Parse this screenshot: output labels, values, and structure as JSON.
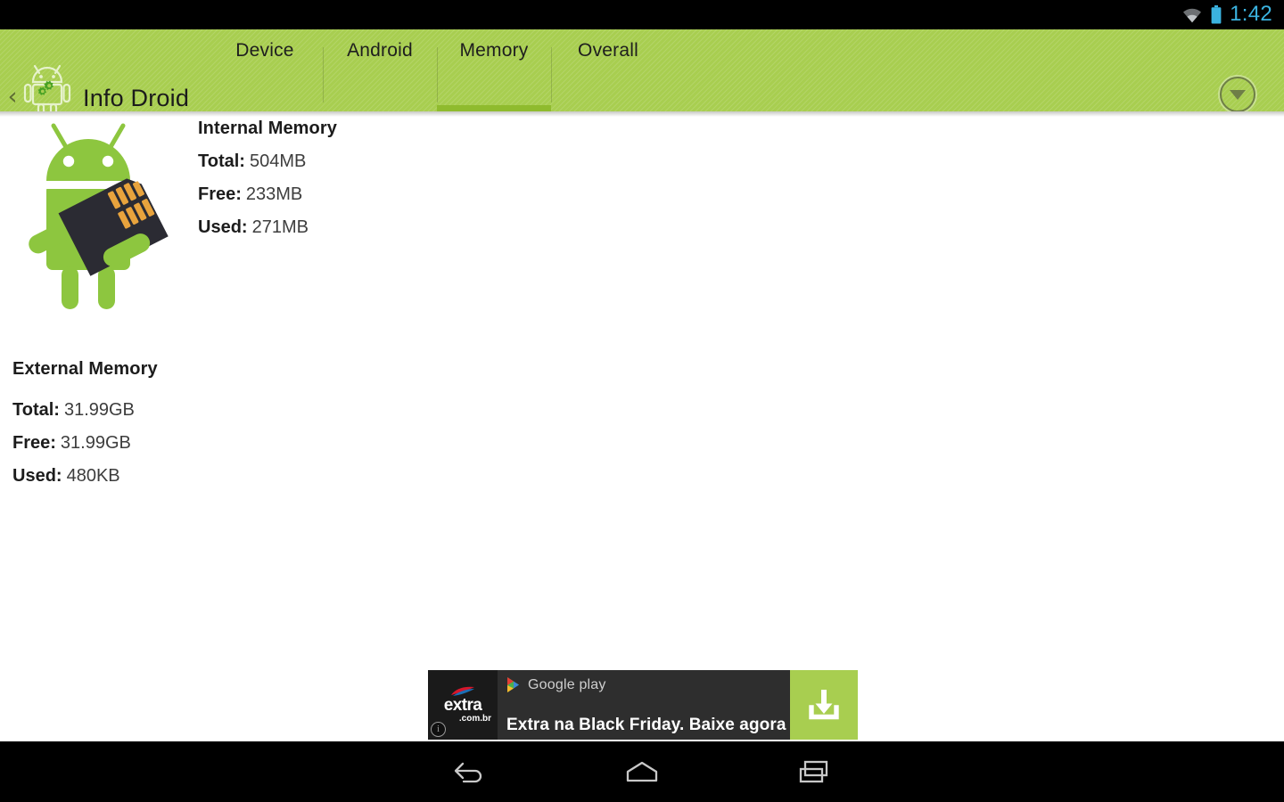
{
  "status_bar": {
    "wifi_icon": "wifi-icon",
    "battery_icon": "battery-icon",
    "time": "1:42",
    "time_color": "#3BB3E0"
  },
  "action_bar": {
    "back_chevron": "‹",
    "app_icon": "android-gears-icon",
    "title": "Info Droid",
    "accent_color": "#A8CE50",
    "active_tab_indicator_color": "#8FBB2E",
    "overflow_button_icon": "circle-chevron-down-icon",
    "tabs": [
      {
        "label": "Device",
        "active": false
      },
      {
        "label": "Android",
        "active": false
      },
      {
        "label": "Memory",
        "active": true
      },
      {
        "label": "Overall",
        "active": false
      }
    ]
  },
  "content": {
    "illustration": "android-robot-holding-sdcard-icon",
    "internal_memory": {
      "title": "Internal Memory",
      "rows": [
        {
          "label": "Total:",
          "value": "504MB"
        },
        {
          "label": "Free:",
          "value": "233MB"
        },
        {
          "label": "Used:",
          "value": "271MB"
        }
      ]
    },
    "external_memory": {
      "title": "External Memory",
      "rows": [
        {
          "label": "Total:",
          "value": "31.99GB"
        },
        {
          "label": "Free:",
          "value": "31.99GB"
        },
        {
          "label": "Used:",
          "value": "480KB"
        }
      ]
    }
  },
  "ad_banner": {
    "advertiser_logo_word": "extra",
    "advertiser_logo_domain": ".com.br",
    "info_badge": "i",
    "store_icon": "google-play-icon",
    "store_name": "Google play",
    "headline": "Extra na Black Friday. Baixe agora",
    "cta_icon": "download-icon",
    "cta_color": "#A8CE50"
  },
  "nav_bar": {
    "buttons": [
      {
        "icon": "back-icon"
      },
      {
        "icon": "home-icon"
      },
      {
        "icon": "recents-icon"
      }
    ]
  }
}
